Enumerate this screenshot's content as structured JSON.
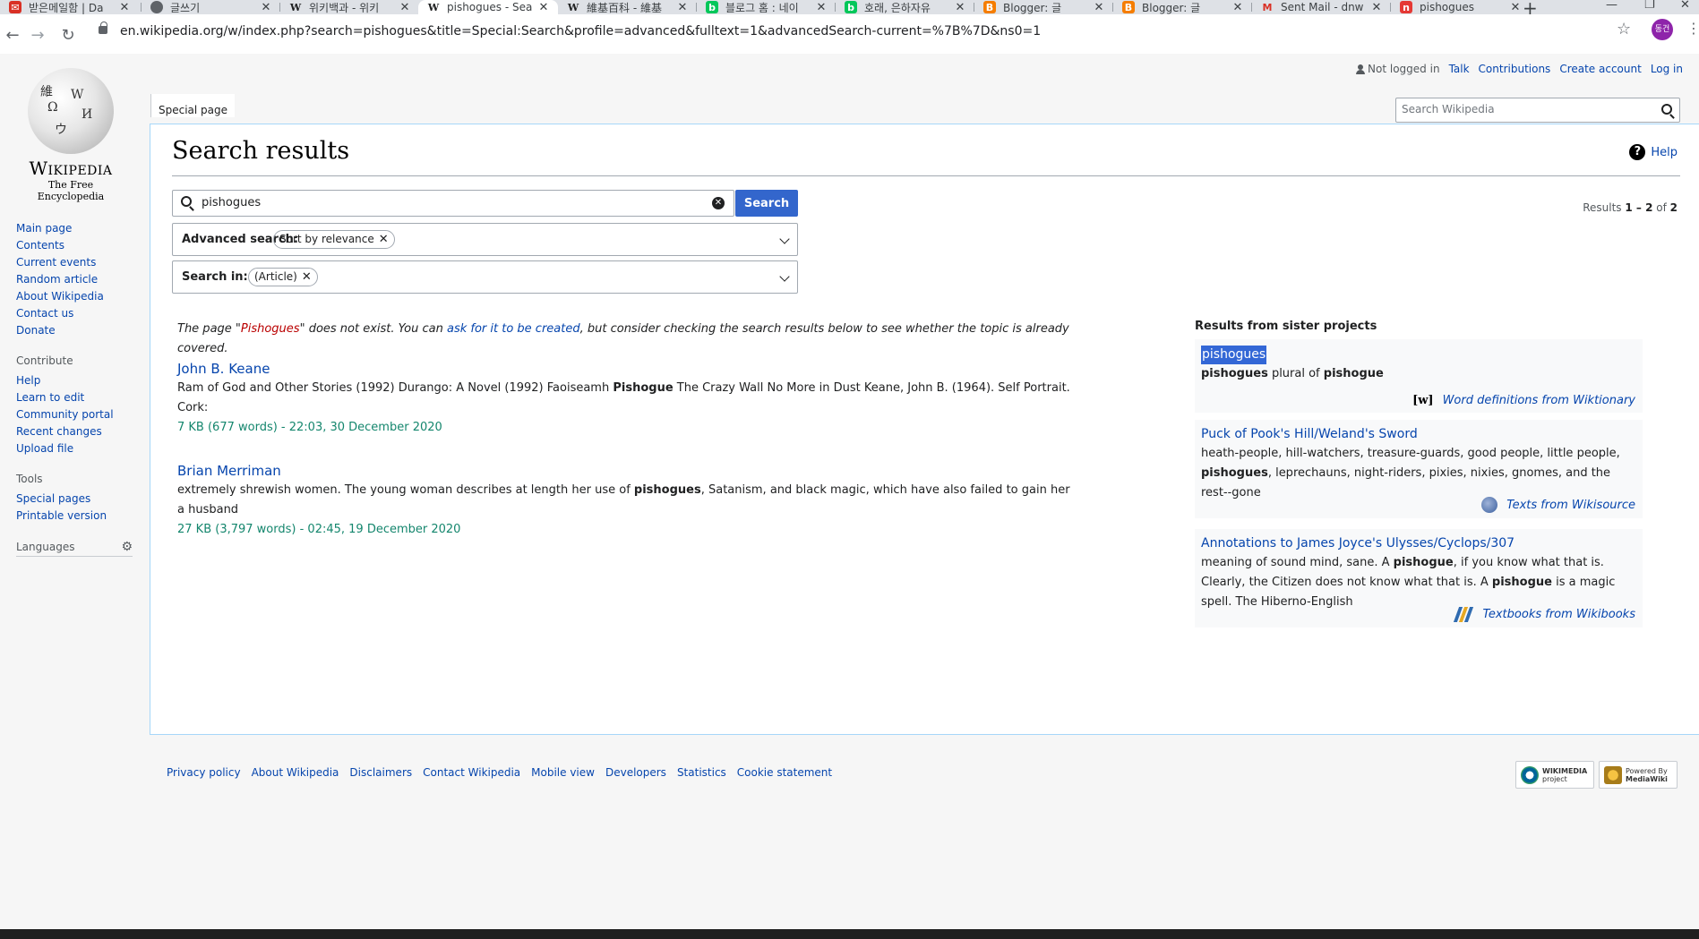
{
  "browser": {
    "tabs": [
      {
        "title": "받은메일함 | Da",
        "favicon": "mail-icon",
        "color": "#d93025"
      },
      {
        "title": "글쓰기",
        "favicon": "chrome-icon",
        "color": "#5f6368"
      },
      {
        "title": "위키백과 - 위키",
        "favicon": "wikipedia-icon",
        "color": "#202122"
      },
      {
        "title": "pishogues - Sea",
        "favicon": "wikipedia-icon",
        "color": "#202122"
      },
      {
        "title": "維基百科 - 維基",
        "favicon": "wikipedia-icon",
        "color": "#202122"
      },
      {
        "title": "블로그 홈 : 네이",
        "favicon": "blog-icon",
        "color": "#03c75a"
      },
      {
        "title": "호래, 은하자유",
        "favicon": "blog-icon",
        "color": "#03c75a"
      },
      {
        "title": "Blogger: 글",
        "favicon": "blogger-icon",
        "color": "#f57d00"
      },
      {
        "title": "Blogger: 글",
        "favicon": "blogger-icon",
        "color": "#f57d00"
      },
      {
        "title": "Sent Mail - dnw",
        "favicon": "gmail-icon",
        "color": "#d93025"
      },
      {
        "title": "pishogues",
        "favicon": "app-icon",
        "color": "#e53935"
      }
    ],
    "active_tab_index": 3,
    "url": "en.wikipedia.org/w/index.php?search=pishogues&title=Special:Search&profile=advanced&fulltext=1&advancedSearch-current=%7B%7D&ns0=1",
    "profile_initials": "동건"
  },
  "wiki": {
    "wordmark": "Wikipedia",
    "tagline": "The Free Encyclopedia",
    "nav": {
      "main": [
        "Main page",
        "Contents",
        "Current events",
        "Random article",
        "About Wikipedia",
        "Contact us",
        "Donate"
      ],
      "contribute_header": "Contribute",
      "contribute": [
        "Help",
        "Learn to edit",
        "Community portal",
        "Recent changes",
        "Upload file"
      ],
      "tools_header": "Tools",
      "tools": [
        "Special pages",
        "Printable version"
      ],
      "languages_header": "Languages"
    },
    "personal": {
      "not_logged_in": "Not logged in",
      "talk": "Talk",
      "contributions": "Contributions",
      "create_account": "Create account",
      "log_in": "Log in"
    },
    "namespace_tab": "Special page",
    "header_search_placeholder": "Search Wikipedia",
    "page_title": "Search results",
    "help_label": "Help",
    "search": {
      "value": "pishogues",
      "button": "Search",
      "results_prefix": "Results ",
      "results_range": "1 – 2",
      "results_of": " of ",
      "results_total": "2"
    },
    "advanced": {
      "label": "Advanced search:",
      "chip": "Sort by relevance"
    },
    "search_in": {
      "label": "Search in:",
      "chip": "(Article)"
    },
    "notice": {
      "part1": "The page \"",
      "page": "Pishogues",
      "part2": "\" does not exist. You can ",
      "link": "ask for it to be created",
      "part3": ", but consider checking the search results below to see whether the topic is already covered."
    },
    "results": [
      {
        "title": "John B. Keane",
        "snippet_pre": "Ram of God and Other Stories (1992) Durango: A Novel (1992) Faoiseamh ",
        "snippet_bold": "Pishogue",
        "snippet_post": " The Crazy Wall No More in Dust Keane, John B. (1964). Self Portrait. Cork:",
        "meta": "7 KB (677 words) - 22:03, 30 December 2020"
      },
      {
        "title": "Brian Merriman",
        "snippet_pre": "extremely shrewish women. The young woman describes at length her use of ",
        "snippet_bold": "pishogues",
        "snippet_post": ", Satanism, and black magic, which have also failed to gain her a husband",
        "meta": "27 KB (3,797 words) - 02:45, 19 December 2020"
      }
    ],
    "sister": {
      "header": "Results from sister projects",
      "items": [
        {
          "title": "pishogues",
          "line_bold1": "pishogues",
          "line_mid": " plural of ",
          "line_bold2": "pishogue",
          "source_glyph": "[w]",
          "source": "Word definitions from Wiktionary"
        },
        {
          "title": "Puck of Pook's Hill/Weland's Sword",
          "snippet_pre": "heath-people, hill-watchers, treasure-guards, good people, little people, ",
          "snippet_bold": "pishogues",
          "snippet_post": ", leprechauns, night-riders, pixies, nixies, gnomes, and the rest--gone",
          "source": "Texts from Wikisource"
        },
        {
          "title": "Annotations to James Joyce's Ulysses/Cyclops/307",
          "snippet_pre": "meaning of sound mind, sane. A ",
          "snippet_bold1": "pishogue",
          "snippet_mid": ", if you know what that is.      Clearly, the Citizen does not know what that is. A ",
          "snippet_bold2": "pishogue",
          "snippet_post": " is a magic spell. The Hiberno-English",
          "source": "Textbooks from Wikibooks"
        }
      ]
    },
    "footer": [
      "Privacy policy",
      "About Wikipedia",
      "Disclaimers",
      "Contact Wikipedia",
      "Mobile view",
      "Developers",
      "Statistics",
      "Cookie statement"
    ],
    "badges": {
      "wikimedia_main": "WIKIMEDIA",
      "wikimedia_sub": "project",
      "mediawiki_top": "Powered By",
      "mediawiki_main": "MediaWiki"
    },
    "link_color": "#0645ad",
    "meta_color": "#14866d",
    "missing_color": "#ba0000"
  }
}
